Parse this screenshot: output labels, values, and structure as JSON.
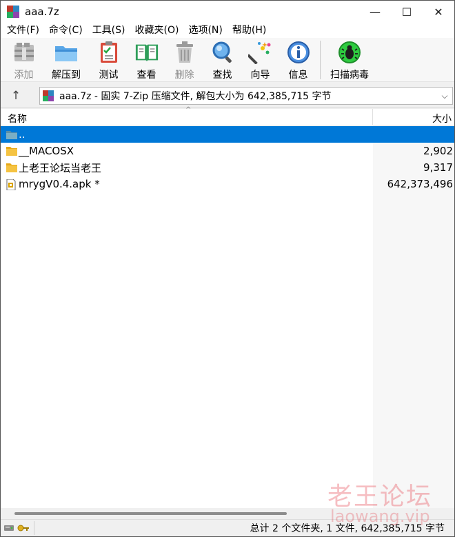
{
  "window": {
    "title": "aaa.7z",
    "controls": {
      "minimize": "—",
      "maximize": "☐",
      "close": "✕"
    }
  },
  "menu": {
    "items": [
      {
        "label": "文件(F)"
      },
      {
        "label": "命令(C)"
      },
      {
        "label": "工具(S)"
      },
      {
        "label": "收藏夹(O)"
      },
      {
        "label": "选项(N)"
      },
      {
        "label": "帮助(H)"
      }
    ]
  },
  "toolbar": {
    "add": "添加",
    "extract": "解压到",
    "test": "测试",
    "view": "查看",
    "delete": "删除",
    "find": "查找",
    "wizard": "向导",
    "info": "信息",
    "scan": "扫描病毒"
  },
  "address": {
    "up": "↑",
    "path": "aaa.7z - 固实 7-Zip 压缩文件, 解包大小为 642,385,715 字节",
    "dropdown": "⌵"
  },
  "filelist": {
    "columns": {
      "name": "名称",
      "size": "大小",
      "sort_indicator": "^"
    },
    "rows": [
      {
        "name": "..",
        "size": "",
        "icon": "parent-folder-icon",
        "selected": true
      },
      {
        "name": "__MACOSX",
        "size": "2,902",
        "icon": "folder-icon",
        "selected": false
      },
      {
        "name": "上老王论坛当老王",
        "size": "9,317",
        "icon": "folder-icon",
        "selected": false
      },
      {
        "name": "mrygV0.4.apk *",
        "size": "642,373,496",
        "icon": "apk-file-icon",
        "selected": false
      }
    ]
  },
  "status": {
    "text": "总计 2 个文件夹, 1 文件, 642,385,715 字节"
  },
  "watermark": {
    "main": "老王论坛",
    "sub": "laowang.vip"
  },
  "colors": {
    "selection": "#0078d7",
    "folder": "#f5c342",
    "watermark": "#e64650"
  }
}
